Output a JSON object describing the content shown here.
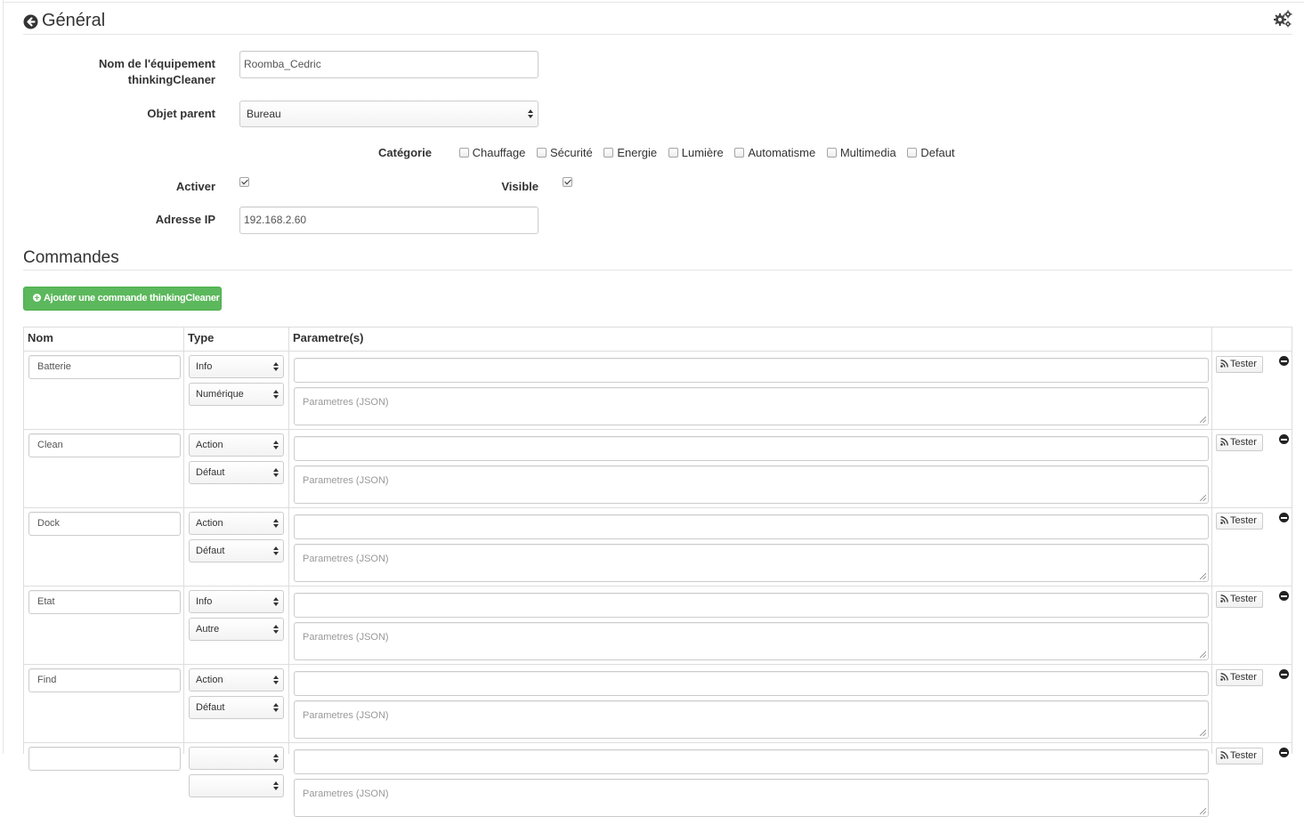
{
  "general": {
    "title": "Général",
    "name_label": "Nom de l'équipement thinkingCleaner",
    "name_value": "Roomba_Cedric",
    "parent_label": "Objet parent",
    "parent_value": "Bureau",
    "category_label": "Catégorie",
    "categories": [
      {
        "label": "Chauffage",
        "checked": false
      },
      {
        "label": "Sécurité",
        "checked": false
      },
      {
        "label": "Energie",
        "checked": false
      },
      {
        "label": "Lumière",
        "checked": false
      },
      {
        "label": "Automatisme",
        "checked": false
      },
      {
        "label": "Multimedia",
        "checked": false
      },
      {
        "label": "Defaut",
        "checked": false
      }
    ],
    "activer_label": "Activer",
    "activer_checked": true,
    "visible_label": "Visible",
    "visible_checked": true,
    "ip_label": "Adresse IP",
    "ip_value": "192.168.2.60"
  },
  "commands": {
    "title": "Commandes",
    "add_button": "Ajouter une commande thinkingCleaner",
    "headers": {
      "name": "Nom",
      "type": "Type",
      "params": "Parametre(s)"
    },
    "params_placeholder": "Parametres (JSON)",
    "tester_label": "Tester",
    "rows": [
      {
        "name": "Batterie",
        "type": "Info",
        "subtype": "Numérique"
      },
      {
        "name": "Clean",
        "type": "Action",
        "subtype": "Défaut"
      },
      {
        "name": "Dock",
        "type": "Action",
        "subtype": "Défaut"
      },
      {
        "name": "Etat",
        "type": "Info",
        "subtype": "Autre"
      },
      {
        "name": "Find",
        "type": "Action",
        "subtype": "Défaut"
      }
    ]
  },
  "icons": {
    "back": "arrow-circle-left-icon",
    "config": "gears-icon",
    "add": "plus-circle-icon",
    "tester": "rss-icon",
    "remove": "minus-circle-icon"
  },
  "colors": {
    "add_button": "#5cb85c",
    "border": "#dddddd"
  }
}
